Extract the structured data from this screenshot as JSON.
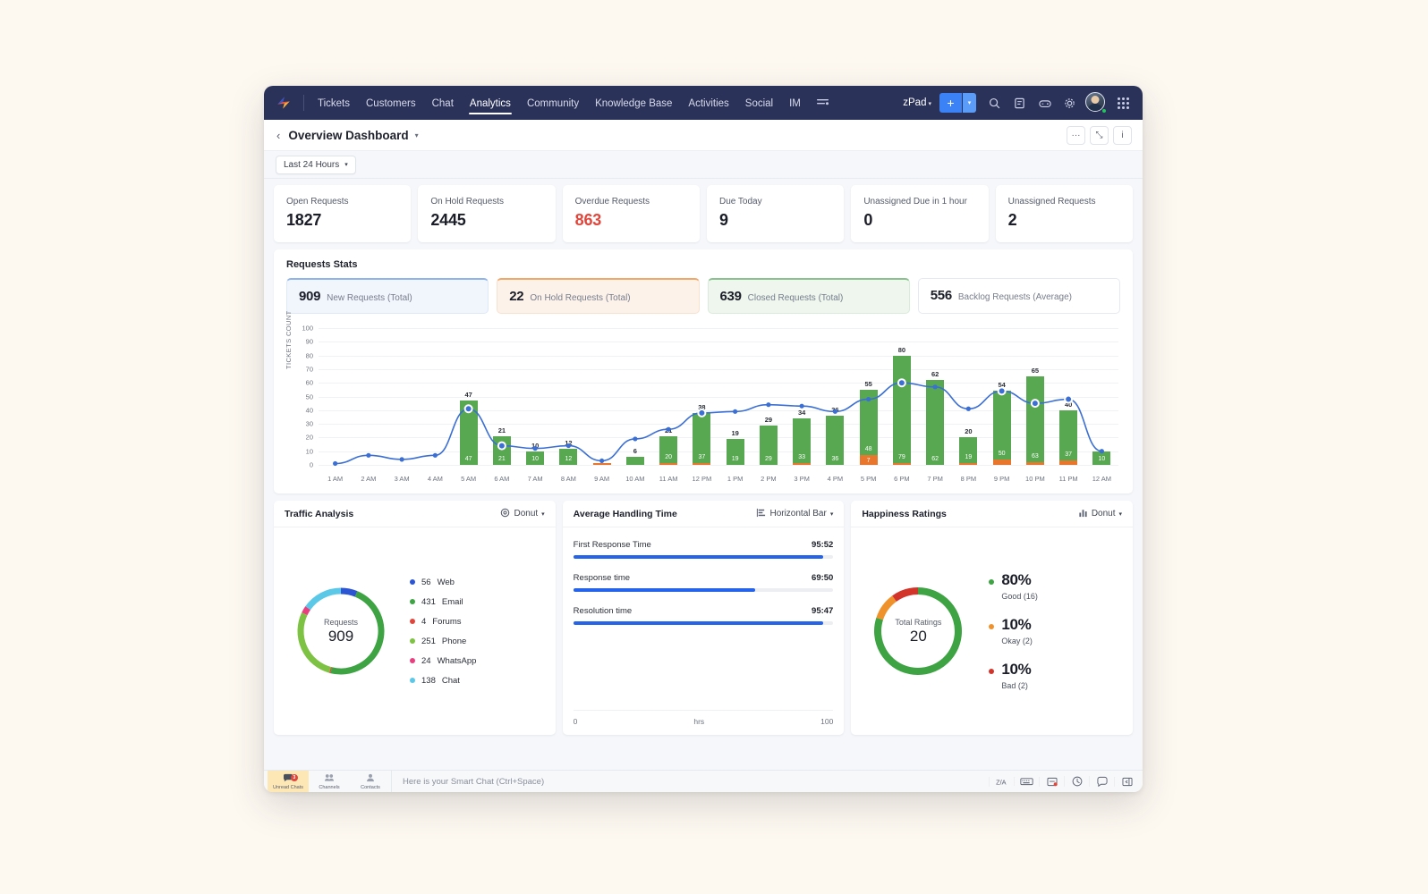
{
  "topnav": {
    "brand_icon": "zoho-desk-logo-icon",
    "items": [
      {
        "label": "Tickets",
        "active": false
      },
      {
        "label": "Customers",
        "active": false
      },
      {
        "label": "Chat",
        "active": false
      },
      {
        "label": "Analytics",
        "active": true
      },
      {
        "label": "Community",
        "active": false
      },
      {
        "label": "Knowledge Base",
        "active": false
      },
      {
        "label": "Activities",
        "active": false
      },
      {
        "label": "Social",
        "active": false
      },
      {
        "label": "IM",
        "active": false
      }
    ],
    "filter_icon": "filter-lines-icon",
    "department": "zPad",
    "add_button": "+",
    "add_dropdown_caret": "▾",
    "icons": [
      "search-icon",
      "notes-icon",
      "gamepad-icon",
      "gear-icon",
      "grid-apps-icon"
    ]
  },
  "header": {
    "back_icon": "chevron-left-icon",
    "title": "Overview Dashboard",
    "title_caret": "▾",
    "actions": [
      {
        "name": "more-options-button",
        "glyph": "···"
      },
      {
        "name": "fullscreen-button",
        "glyph": "⤡"
      },
      {
        "name": "info-button",
        "glyph": "i"
      }
    ]
  },
  "filters": {
    "date_range": "Last 24 Hours",
    "caret": "▾"
  },
  "kpis": [
    {
      "label": "Open Requests",
      "value": "1827",
      "danger": false
    },
    {
      "label": "On Hold Requests",
      "value": "2445",
      "danger": false
    },
    {
      "label": "Overdue Requests",
      "value": "863",
      "danger": true
    },
    {
      "label": "Due Today",
      "value": "9",
      "danger": false
    },
    {
      "label": "Unassigned Due in 1 hour",
      "value": "0",
      "danger": false
    },
    {
      "label": "Unassigned Requests",
      "value": "2",
      "danger": false
    }
  ],
  "requests_stats": {
    "title": "Requests Stats",
    "pills": [
      {
        "value": "909",
        "label": "New Requests",
        "qualifier": "(Total)",
        "theme": "blue"
      },
      {
        "value": "22",
        "label": "On Hold Requests",
        "qualifier": "(Total)",
        "theme": "orange"
      },
      {
        "value": "639",
        "label": "Closed Requests",
        "qualifier": "(Total)",
        "theme": "green"
      },
      {
        "value": "556",
        "label": "Backlog Requests",
        "qualifier": "(Average)",
        "theme": "plain"
      }
    ]
  },
  "chart_data": {
    "type": "bar",
    "title": "Requests Stats",
    "xlabel": "",
    "ylabel": "TICKETS COUNT",
    "ylim": [
      0,
      100
    ],
    "yticks": [
      0,
      10,
      20,
      30,
      40,
      50,
      60,
      70,
      80,
      90,
      100
    ],
    "grid": true,
    "legend": "none",
    "categories": [
      "1 AM",
      "2 AM",
      "3 AM",
      "4 AM",
      "5 AM",
      "6 AM",
      "7 AM",
      "8 AM",
      "9 AM",
      "10 AM",
      "11 AM",
      "12 PM",
      "1 PM",
      "2 PM",
      "3 PM",
      "4 PM",
      "5 PM",
      "6 PM",
      "7 PM",
      "8 PM",
      "9 PM",
      "10 PM",
      "11 PM",
      "12 AM"
    ],
    "bar_totals": [
      0,
      0,
      0,
      0,
      47,
      21,
      10,
      12,
      1,
      6,
      21,
      38,
      19,
      29,
      34,
      36,
      55,
      80,
      62,
      20,
      54,
      65,
      40,
      10
    ],
    "series": [
      {
        "name": "Closed",
        "color": "#57a851",
        "values": [
          0,
          0,
          0,
          0,
          47,
          21,
          10,
          12,
          0,
          6,
          20,
          37,
          19,
          29,
          33,
          36,
          48,
          79,
          62,
          19,
          50,
          63,
          37,
          10
        ]
      },
      {
        "name": "On Hold",
        "color": "#e8762c",
        "values": [
          0,
          0,
          0,
          0,
          0,
          0,
          0,
          0,
          1,
          0,
          1,
          1,
          0,
          0,
          1,
          0,
          7,
          1,
          0,
          1,
          4,
          2,
          3,
          0
        ]
      },
      {
        "name": "New Requests",
        "color": "#3b6fd4",
        "type": "line",
        "values": [
          1,
          7,
          4,
          7,
          41,
          14,
          12,
          14,
          3,
          19,
          26,
          38,
          39,
          44,
          43,
          39,
          48,
          60,
          57,
          41,
          54,
          45,
          48,
          10
        ]
      }
    ],
    "bar_labels_total": [
      "",
      "",
      "",
      "",
      "47",
      "21",
      "10",
      "12",
      "",
      "6",
      "21",
      "38",
      "19",
      "29",
      "34",
      "36",
      "55",
      "80",
      "62",
      "20",
      "54",
      "65",
      "40",
      ""
    ],
    "bar_labels_green": [
      "",
      "",
      "",
      "",
      "47",
      "21",
      "10",
      "12",
      "",
      "",
      "20",
      "37",
      "19",
      "29",
      "33",
      "36",
      "48",
      "79",
      "62",
      "19",
      "50",
      "63",
      "37",
      "10"
    ],
    "bar_labels_orange": [
      "",
      "",
      "",
      "",
      "",
      "",
      "",
      "",
      "",
      "",
      "",
      "",
      "",
      "",
      "",
      "",
      "7",
      "",
      "",
      "",
      "",
      "",
      "",
      ""
    ]
  },
  "traffic": {
    "title": "Traffic Analysis",
    "type_label": "Donut",
    "type_icon": "donut-chart-icon",
    "caret": "▾",
    "center_caption": "Requests",
    "center_value": "909",
    "chart_data": {
      "type": "pie",
      "title": "Traffic Analysis",
      "labels": [
        "Web",
        "Email",
        "Forums",
        "Phone",
        "WhatsApp",
        "Chat"
      ],
      "values": [
        56,
        431,
        4,
        251,
        24,
        138
      ],
      "total": 909,
      "colors": [
        "#2c55d4",
        "#3da343",
        "#e0473c",
        "#7dc242",
        "#e8407f",
        "#5bc8e8"
      ]
    },
    "legend": [
      {
        "value": "56",
        "label": "Web",
        "color": "#2c55d4"
      },
      {
        "value": "431",
        "label": "Email",
        "color": "#3da343"
      },
      {
        "value": "4",
        "label": "Forums",
        "color": "#e0473c"
      },
      {
        "value": "251",
        "label": "Phone",
        "color": "#7dc242"
      },
      {
        "value": "24",
        "label": "WhatsApp",
        "color": "#e8407f"
      },
      {
        "value": "138",
        "label": "Chat",
        "color": "#5bc8e8"
      }
    ]
  },
  "handling": {
    "title": "Average Handling Time",
    "type_label": "Horizontal Bar",
    "type_icon": "horizontal-bar-chart-icon",
    "caret": "▾",
    "chart_data": {
      "type": "bar",
      "orientation": "horizontal",
      "title": "Average Handling Time",
      "categories": [
        "First Response Time",
        "Response time",
        "Resolution time"
      ],
      "values": [
        95.87,
        69.83,
        95.78
      ],
      "value_labels": [
        "95:52",
        "69:50",
        "95:47"
      ],
      "xlim": [
        0,
        100
      ],
      "xlabel": "hrs",
      "bar_color": "#2563eb"
    },
    "rows": [
      {
        "label": "First Response Time",
        "value": "95:52",
        "pct": 96
      },
      {
        "label": "Response time",
        "value": "69:50",
        "pct": 70
      },
      {
        "label": "Resolution time",
        "value": "95:47",
        "pct": 96
      }
    ],
    "axis_min": "0",
    "axis_unit": "hrs",
    "axis_max": "100"
  },
  "happiness": {
    "title": "Happiness Ratings",
    "type_label": "Donut",
    "type_icon": "bar-chart-icon",
    "caret": "▾",
    "center_caption": "Total Ratings",
    "center_value": "20",
    "chart_data": {
      "type": "pie",
      "title": "Happiness Ratings",
      "labels": [
        "Good",
        "Okay",
        "Bad"
      ],
      "values": [
        16,
        2,
        2
      ],
      "percents": [
        80,
        10,
        10
      ],
      "total": 20,
      "colors": [
        "#3da343",
        "#f0922b",
        "#d3342a"
      ]
    },
    "legend": [
      {
        "pct": "80%",
        "label": "Good (16)",
        "color": "#3da343"
      },
      {
        "pct": "10%",
        "label": "Okay (2)",
        "color": "#f0922b"
      },
      {
        "pct": "10%",
        "label": "Bad (2)",
        "color": "#d3342a"
      }
    ]
  },
  "taskbar": {
    "tiles": [
      {
        "label": "Unread Chats",
        "icon": "chat-bubble-icon",
        "badge": "3",
        "active": true
      },
      {
        "label": "Channels",
        "icon": "channels-icon",
        "badge": "",
        "active": false
      },
      {
        "label": "Contacts",
        "icon": "contacts-icon",
        "badge": "",
        "active": false
      }
    ],
    "smart_chat_placeholder": "Here is your Smart Chat (Ctrl+Space)",
    "right_icons": [
      "translate-icon",
      "keyboard-icon",
      "tasks-icon",
      "history-icon",
      "feedback-icon",
      "collapse-icon"
    ]
  }
}
